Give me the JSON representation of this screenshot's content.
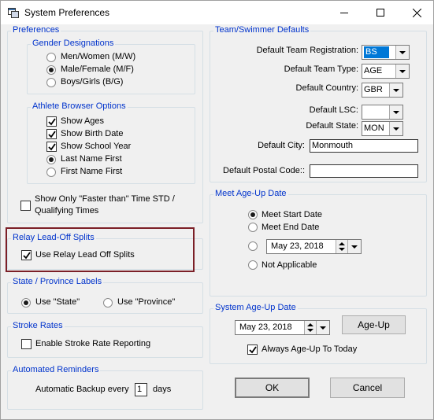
{
  "window": {
    "title": "System Preferences"
  },
  "preferences": {
    "label": "Preferences",
    "gender": {
      "label": "Gender Designations",
      "options": [
        "Men/Women (M/W)",
        "Male/Female (M/F)",
        "Boys/Girls (B/G)"
      ],
      "selected": "Male/Female (M/F)"
    },
    "athlete_browser": {
      "label": "Athlete Browser Options",
      "show_ages": "Show Ages",
      "show_birth_date": "Show Birth Date",
      "show_school_year": "Show School Year",
      "last_name_first": "Last Name First",
      "first_name_first": "First Name First"
    },
    "show_only_line1": "Show Only  \"Faster than\" Time STD /",
    "show_only_line2": "Qualifying Times"
  },
  "relay": {
    "label": "Relay Lead-Off Splits",
    "checkbox": "Use Relay Lead Off Splits"
  },
  "state_province": {
    "label": "State / Province Labels",
    "state": "Use \"State\"",
    "province": "Use \"Province\""
  },
  "stroke_rates": {
    "label": "Stroke Rates",
    "checkbox": "Enable Stroke Rate Reporting"
  },
  "reminders": {
    "label": "Automated Reminders",
    "prefix": "Automatic Backup every",
    "value": "1",
    "suffix": "days"
  },
  "team_defaults": {
    "label": "Team/Swimmer Defaults",
    "registration_label": "Default Team Registration:",
    "registration_value": "BS",
    "team_type_label": "Default Team Type:",
    "team_type_value": "AGE",
    "country_label": "Default Country:",
    "country_value": "GBR",
    "lsc_label": "Default LSC:",
    "lsc_value": "",
    "state_label": "Default State:",
    "state_value": "MON",
    "city_label": "Default City:",
    "city_value": "Monmouth",
    "postal_label": "Default Postal Code::",
    "postal_value": ""
  },
  "meet_ageup": {
    "label": "Meet Age-Up Date",
    "start": "Meet Start Date",
    "end": "Meet End Date",
    "date": "May 23, 2018",
    "not_applicable": "Not Applicable"
  },
  "system_ageup": {
    "label": "System Age-Up Date",
    "date": "May 23, 2018",
    "button": "Age-Up",
    "always_label": "Always Age-Up To Today"
  },
  "buttons": {
    "ok": "OK",
    "cancel": "Cancel"
  },
  "colors": {
    "group_label": "#0033cc",
    "highlight": "#7b1f27",
    "selection": "#0078d7"
  }
}
